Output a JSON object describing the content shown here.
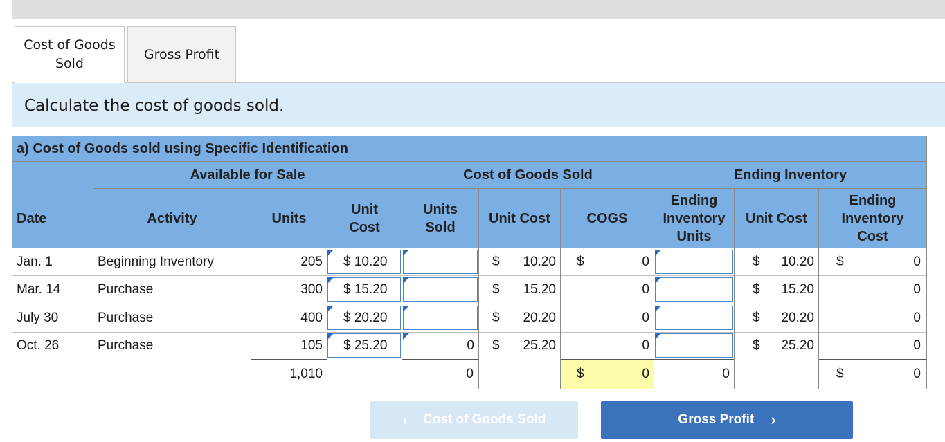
{
  "tabs": [
    {
      "label": "Cost of Goods Sold",
      "line1": "Cost of Goods",
      "line2": "Sold"
    },
    {
      "label": "Gross Profit"
    }
  ],
  "instruction": "Calculate the cost of goods sold.",
  "table": {
    "title": "a) Cost of Goods sold using Specific Identification",
    "groups": {
      "available": "Available for Sale",
      "cogs": "Cost of Goods Sold",
      "ending": "Ending Inventory"
    },
    "columns": {
      "date": "Date",
      "activity": "Activity",
      "units": "Units",
      "unit_cost_1": "Unit",
      "unit_cost_2": "Cost",
      "units_sold_1": "Units",
      "units_sold_2": "Sold",
      "cogs_unit_cost": "Unit Cost",
      "cogs": "COGS",
      "end_units_1": "Ending",
      "end_units_2": "Inventory",
      "end_units_3": "Units",
      "end_unit_cost": "Unit Cost",
      "end_cost_1": "Ending",
      "end_cost_2": "Inventory",
      "end_cost_3": "Cost"
    },
    "rows": [
      {
        "date": "Jan. 1",
        "activity": "Beginning Inventory",
        "units": "205",
        "unit_cost": "$ 10.20",
        "units_sold": "",
        "cogs_cur": "$",
        "cogs_unit_cost": "10.20",
        "cogs_dollar": "$",
        "cogs": "0",
        "end_units": "",
        "end_cur": "$",
        "end_unit_cost": "10.20",
        "end_dollar": "$",
        "end_cost": "0"
      },
      {
        "date": "Mar. 14",
        "activity": "Purchase",
        "units": "300",
        "unit_cost": "$ 15.20",
        "units_sold": "",
        "cogs_cur": "$",
        "cogs_unit_cost": "15.20",
        "cogs_dollar": "",
        "cogs": "0",
        "end_units": "",
        "end_cur": "$",
        "end_unit_cost": "15.20",
        "end_dollar": "",
        "end_cost": "0"
      },
      {
        "date": "July 30",
        "activity": "Purchase",
        "units": "400",
        "unit_cost": "$ 20.20",
        "units_sold": "",
        "cogs_cur": "$",
        "cogs_unit_cost": "20.20",
        "cogs_dollar": "",
        "cogs": "0",
        "end_units": "",
        "end_cur": "$",
        "end_unit_cost": "20.20",
        "end_dollar": "",
        "end_cost": "0"
      },
      {
        "date": "Oct. 26",
        "activity": "Purchase",
        "units": "105",
        "unit_cost": "$ 25.20",
        "units_sold": "0",
        "cogs_cur": "$",
        "cogs_unit_cost": "25.20",
        "cogs_dollar": "",
        "cogs": "0",
        "end_units": "",
        "end_cur": "$",
        "end_unit_cost": "25.20",
        "end_dollar": "",
        "end_cost": "0"
      }
    ],
    "totals": {
      "units": "1,010",
      "units_sold": "0",
      "cogs_dollar": "$",
      "cogs": "0",
      "end_units": "0",
      "end_dollar": "$",
      "end_cost": "0"
    },
    "highlight_color": "#fbfbaa",
    "header_color": "#7bafe3"
  },
  "nav": {
    "prev_label": "Cost of Goods Sold",
    "next_label": "Gross Profit",
    "prev_icon": "chevron-left-icon",
    "next_icon": "chevron-right-icon"
  }
}
